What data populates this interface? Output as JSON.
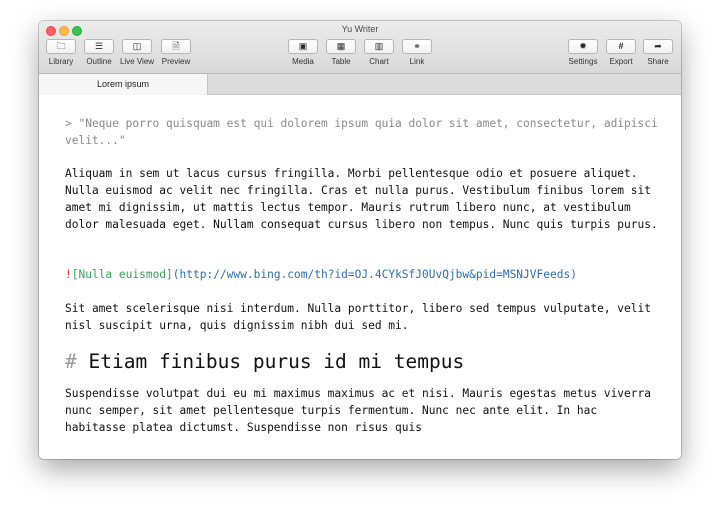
{
  "window": {
    "title": "Yu Writer"
  },
  "toolbar": {
    "items": [
      {
        "label": "Library",
        "icon": "folder-icon",
        "glyph": "🗀"
      },
      {
        "label": "Outline",
        "icon": "list-icon",
        "glyph": "☰"
      },
      {
        "label": "Live View",
        "icon": "columns-icon",
        "glyph": "◫"
      },
      {
        "label": "Preview",
        "icon": "document-icon",
        "glyph": "🗎"
      },
      {
        "label": "Media",
        "icon": "image-icon",
        "glyph": "▣"
      },
      {
        "label": "Table",
        "icon": "table-icon",
        "glyph": "▦"
      },
      {
        "label": "Chart",
        "icon": "chart-icon",
        "glyph": "▥"
      },
      {
        "label": "Link",
        "icon": "link-icon",
        "glyph": "⚭"
      },
      {
        "label": "Settings",
        "icon": "gear-icon",
        "glyph": "✹"
      },
      {
        "label": "Export",
        "icon": "hash-icon",
        "glyph": "#"
      },
      {
        "label": "Share",
        "icon": "share-arrow-icon",
        "glyph": "➦"
      }
    ]
  },
  "tabs": [
    {
      "label": "Lorem ipsum",
      "active": true
    }
  ],
  "editor": {
    "quote": "> \"Neque porro quisquam est qui dolorem ipsum quia dolor sit amet, consectetur, adipisci velit...\"",
    "paragraph1": "Aliquam in sem ut lacus cursus fringilla. Morbi pellentesque odio et posuere aliquet. Nulla euismod ac velit nec fringilla. Cras et nulla purus. Vestibulum finibus lorem sit amet mi dignissim, ut mattis lectus tempor. Mauris rutrum libero nunc, at vestibulum dolor malesuada eget. Nullam consequat cursus libero non tempus. Nunc quis turpis purus.",
    "image": {
      "bang": "!",
      "alt": "[Nulla euismod]",
      "url": "(http://www.bing.com/th?id=OJ.4CYkSfJ0UvQjbw&pid=MSNJVFeeds)"
    },
    "paragraph2": "Sit amet scelerisque nisi interdum. Nulla porttitor, libero sed tempus vulputate, velit nisl suscipit urna, quis dignissim nibh dui sed mi.",
    "heading": {
      "hash": "#",
      "text": "Etiam finibus purus id mi tempus"
    },
    "paragraph3": "Suspendisse volutpat dui eu mi maximus maximus ac et nisi. Mauris egestas metus viverra nunc semper, sit amet pellentesque turpis fermentum. Nunc nec ante elit. In hac habitasse platea dictumst. Suspendisse non risus quis"
  },
  "colors": {
    "syntax_bang": "#d9342b",
    "syntax_alt": "#3aa05a",
    "syntax_url": "#2f6fb0",
    "quote_text": "#8a8a8a"
  }
}
